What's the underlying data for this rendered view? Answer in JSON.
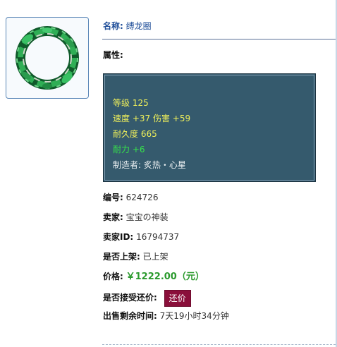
{
  "item": {
    "name_label": "名称:",
    "name_value": "缚龙圈",
    "attr_label": "属性:",
    "icon": "green-vine-ring-icon"
  },
  "attributes": [
    {
      "text": "等级 125",
      "color": "#f0f05a"
    },
    {
      "text": "速度 +37 伤害 +59",
      "color": "#f0f05a"
    },
    {
      "text": "耐久度 665",
      "color": "#f0f05a"
    },
    {
      "text": "耐力 +6",
      "color": "#36e24a"
    },
    {
      "text": "制造者: 炙热・心星",
      "color": "#eef2f4"
    }
  ],
  "details": {
    "id_label": "编号:",
    "id_value": "624726",
    "seller_label": "卖家:",
    "seller_value": "宝宝の神装",
    "seller_id_label": "卖家ID:",
    "seller_id_value": "16794737",
    "listed_label": "是否上架:",
    "listed_value": "已上架",
    "price_label": "价格:",
    "price_value": "￥1222.00（元）",
    "bargain_label": "是否接受还价:",
    "bargain_button": "还价",
    "time_label": "出售剩余时间:",
    "time_value": "7天19小时34分钟"
  },
  "colors": {
    "attr_bg": "#355a6d",
    "button_bg": "#8a0f3a",
    "price": "#2b9a2e",
    "name": "#1f4e99"
  }
}
